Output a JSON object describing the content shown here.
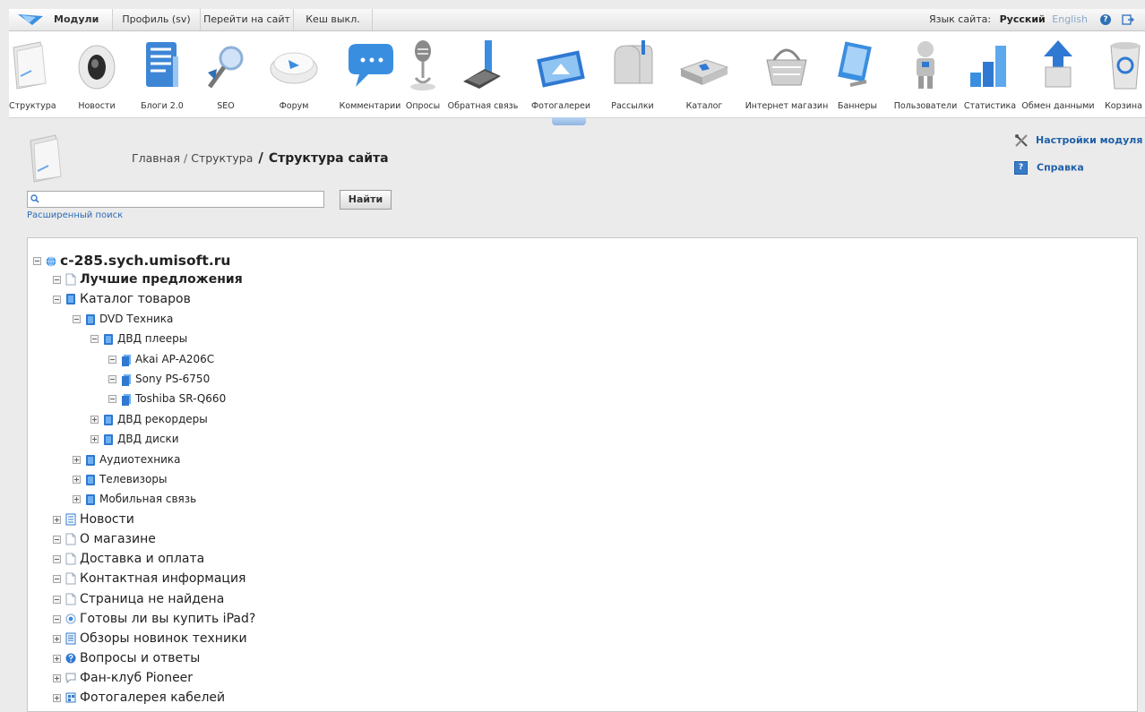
{
  "topbar": {
    "modules": "Модули",
    "profile": "Профиль (sv)",
    "goto_site": "Перейти на сайт",
    "cache": "Кеш выкл.",
    "lang_label": "Язык сайта:",
    "lang_current": "Русский",
    "lang_alt": "English",
    "help_glyph": "?"
  },
  "modules": [
    {
      "label": "Структура",
      "icon": "structure-icon"
    },
    {
      "label": "Новости",
      "icon": "news-icon"
    },
    {
      "label": "Блоги 2.0",
      "icon": "blogs-icon"
    },
    {
      "label": "SEO",
      "icon": "seo-icon"
    },
    {
      "label": "Форум",
      "icon": "forum-icon"
    },
    {
      "label": "Комментарии",
      "icon": "comments-icon"
    },
    {
      "label": "Опросы",
      "icon": "polls-icon"
    },
    {
      "label": "Обратная связь",
      "icon": "feedback-icon"
    },
    {
      "label": "Фотогалереи",
      "icon": "photogallery-icon"
    },
    {
      "label": "Рассылки",
      "icon": "mailing-icon"
    },
    {
      "label": "Каталог",
      "icon": "catalog-icon"
    },
    {
      "label": "Интернет магазин",
      "icon": "shop-icon"
    },
    {
      "label": "Баннеры",
      "icon": "banners-icon"
    },
    {
      "label": "Пользователи",
      "icon": "users-icon"
    },
    {
      "label": "Статистика",
      "icon": "statistics-icon"
    },
    {
      "label": "Обмен данными",
      "icon": "exchange-icon"
    },
    {
      "label": "Корзина",
      "icon": "trash-icon"
    }
  ],
  "breadcrumb": {
    "home": "Главная",
    "section": "Структура",
    "current": "Структура сайта"
  },
  "side_links": {
    "settings": "Настройки модуля",
    "help": "Справка",
    "help_glyph": "?"
  },
  "search": {
    "value": "",
    "button": "Найти",
    "advanced": "Расширенный поиск"
  },
  "tree": {
    "root": "c-285.sych.umisoft.ru",
    "best": "Лучшие предложения",
    "catalog": "Каталог товаров",
    "dvd_tech": "DVD Техника",
    "dvd_players": "ДВД плееры",
    "akai": "Akai AP-A206C",
    "sony": "Sony PS-6750",
    "toshiba": "Toshiba SR-Q660",
    "dvd_recorders": "ДВД рекордеры",
    "dvd_discs": "ДВД диски",
    "audio": "Аудиотехника",
    "tv": "Телевизоры",
    "mobile": "Мобильная связь",
    "news": "Новости",
    "about": "О магазине",
    "delivery": "Доставка и оплата",
    "contacts": "Контактная информация",
    "notfound": "Страница не найдена",
    "poll": "Готовы ли вы купить iPad?",
    "reviews": "Обзоры новинок техники",
    "faq": "Вопросы и ответы",
    "fanclub": "Фан-клуб Pioneer",
    "gallery": "Фотогалерея кабелей"
  },
  "colors": {
    "accent_blue": "#2a6bb5",
    "folder_blue": "#2f79d2",
    "background": "#ebebeb"
  }
}
